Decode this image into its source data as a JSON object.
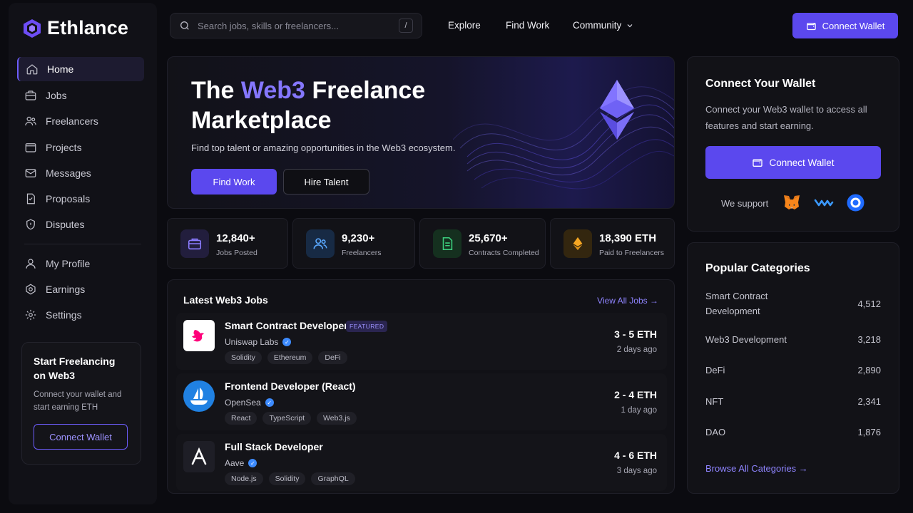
{
  "app": {
    "name": "Ethlance"
  },
  "sidebar": {
    "items": [
      {
        "label": "Home",
        "icon": "home-icon",
        "active": true
      },
      {
        "label": "Jobs",
        "icon": "briefcase-icon"
      },
      {
        "label": "Freelancers",
        "icon": "users-icon"
      },
      {
        "label": "Projects",
        "icon": "folder-icon"
      },
      {
        "label": "Messages",
        "icon": "mail-icon"
      },
      {
        "label": "Proposals",
        "icon": "proposal-icon"
      },
      {
        "label": "Disputes",
        "icon": "shield-icon"
      }
    ],
    "account_items": [
      {
        "label": "My Profile",
        "icon": "user-icon"
      },
      {
        "label": "Earnings",
        "icon": "earnings-icon"
      },
      {
        "label": "Settings",
        "icon": "gear-icon"
      }
    ],
    "promo": {
      "title": "Start Freelancing on Web3",
      "text": "Connect your wallet and start earning ETH",
      "button": "Connect Wallet"
    }
  },
  "header": {
    "search_placeholder": "Search jobs, skills or freelancers...",
    "search_shortcut": "/",
    "nav": [
      "Explore",
      "Find Work",
      "Community"
    ],
    "connect_label": "Connect Wallet"
  },
  "hero": {
    "title_part1": "The",
    "title_accent": "Web3",
    "title_part2": "Freelance",
    "title_line2": "Marketplace",
    "subtitle": "Find top talent or amazing opportunities in the Web3 ecosystem.",
    "primary_button": "Find Work",
    "secondary_button": "Hire Talent"
  },
  "stats": [
    {
      "value": "12,840+",
      "label": "Jobs Posted",
      "icon": "briefcase-icon",
      "color": "#8b7cff"
    },
    {
      "value": "9,230+",
      "label": "Freelancers",
      "icon": "users-icon",
      "color": "#5aa8ff"
    },
    {
      "value": "25,670+",
      "label": "Contracts Completed",
      "icon": "document-icon",
      "color": "#3ccf7e"
    },
    {
      "value": "18,390 ETH",
      "label": "Paid to Freelancers",
      "icon": "ethereum-icon",
      "color": "#f5a623"
    }
  ],
  "jobs": {
    "title": "Latest Web3 Jobs",
    "view_all": "View All Jobs",
    "items": [
      {
        "title": "Smart Contract Developer",
        "badge": "FEATURED",
        "company": "Uniswap Labs",
        "tags": [
          "Solidity",
          "Ethereum",
          "DeFi"
        ],
        "pay": "3 - 5 ETH",
        "posted": "2 days ago",
        "logo": "uniswap-logo"
      },
      {
        "title": "Frontend Developer (React)",
        "badge": "",
        "company": "OpenSea",
        "tags": [
          "React",
          "TypeScript",
          "Web3.js"
        ],
        "pay": "2 - 4 ETH",
        "posted": "1 day ago",
        "logo": "opensea-logo"
      },
      {
        "title": "Full Stack Developer",
        "badge": "",
        "company": "Aave",
        "tags": [
          "Node.js",
          "Solidity",
          "GraphQL"
        ],
        "pay": "4 - 6 ETH",
        "posted": "3 days ago",
        "logo": "aave-logo"
      }
    ]
  },
  "wallet_card": {
    "title": "Connect Your Wallet",
    "text": "Connect your Web3 wallet to access all features and start earning.",
    "button": "Connect Wallet",
    "support_label": "We support",
    "wallets": [
      "metamask-icon",
      "walletconnect-icon",
      "coinbase-icon"
    ]
  },
  "categories": {
    "title": "Popular Categories",
    "items": [
      {
        "name": "Smart Contract Development",
        "count": "4,512"
      },
      {
        "name": "Web3 Development",
        "count": "3,218"
      },
      {
        "name": "DeFi",
        "count": "2,890"
      },
      {
        "name": "NFT",
        "count": "2,341"
      },
      {
        "name": "DAO",
        "count": "1,876"
      }
    ],
    "browse_all": "Browse All Categories"
  },
  "colors": {
    "accent": "#5b48ee",
    "accent_text": "#8f84ff",
    "background": "#0b0b10"
  }
}
